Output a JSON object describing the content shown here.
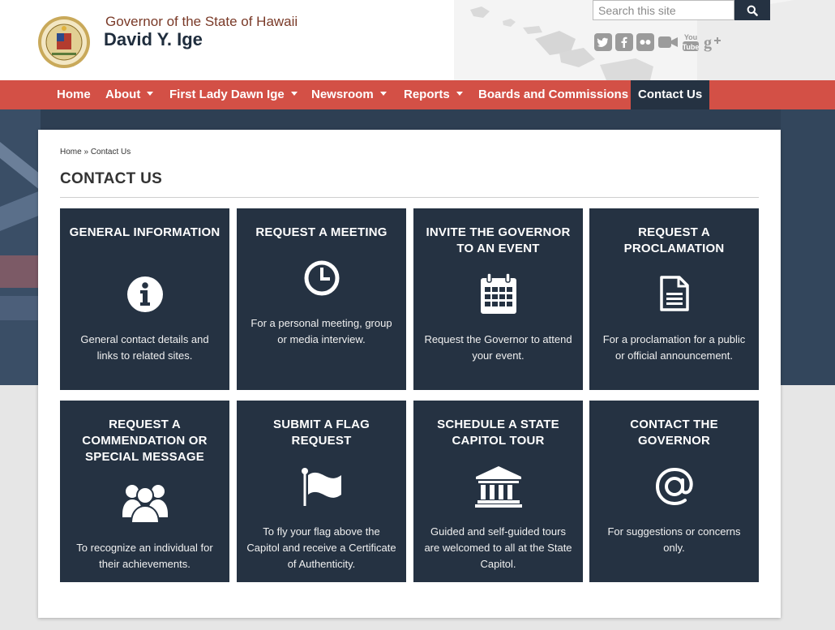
{
  "header": {
    "title": "Governor of the State of Hawaii",
    "name": "David Y. Ige",
    "search_placeholder": "Search this site",
    "social": [
      "twitter-icon",
      "facebook-icon",
      "flickr-icon",
      "video-camera-icon",
      "youtube-icon",
      "google-plus-icon"
    ]
  },
  "nav": {
    "items": [
      {
        "label": "Home"
      },
      {
        "label": "About"
      },
      {
        "label": "First Lady Dawn Ige"
      },
      {
        "label": "Newsroom"
      },
      {
        "label": "Reports"
      },
      {
        "label": "Boards and Commissions"
      },
      {
        "label": "Contact Us"
      }
    ]
  },
  "breadcrumb": {
    "home": "Home",
    "sep": "»",
    "current": "Contact Us"
  },
  "page_title": "CONTACT US",
  "tiles": [
    {
      "title": "General Information",
      "icon": "info-icon",
      "desc": "General contact details and links to related sites."
    },
    {
      "title": "Request a Meeting",
      "icon": "clock-icon",
      "desc": "For a personal meeting, group or media interview."
    },
    {
      "title": "Invite the Governor to an Event",
      "icon": "calendar-icon",
      "desc": "Request the Governor to attend your event."
    },
    {
      "title": "Request a Proclamation",
      "icon": "document-icon",
      "desc": "For a proclamation for a public or official announcement."
    },
    {
      "title": "Request a Commendation or Special Message",
      "icon": "group-icon",
      "desc": "To recognize an individual for their achievements."
    },
    {
      "title": "Submit a Flag Request",
      "icon": "flag-icon",
      "desc": "To fly your flag above the Capitol and receive a Certificate of Authenticity."
    },
    {
      "title": "Schedule a State Capitol Tour",
      "icon": "building-icon",
      "desc": "Guided and self-guided tours are welcomed to all at the State Capitol."
    },
    {
      "title": "Contact the Governor",
      "icon": "at-sign-icon",
      "desc": "For suggestions or concerns only."
    }
  ],
  "colors": {
    "nav": "#d35046",
    "dark": "#253242",
    "accent_text": "#7a3a28"
  }
}
